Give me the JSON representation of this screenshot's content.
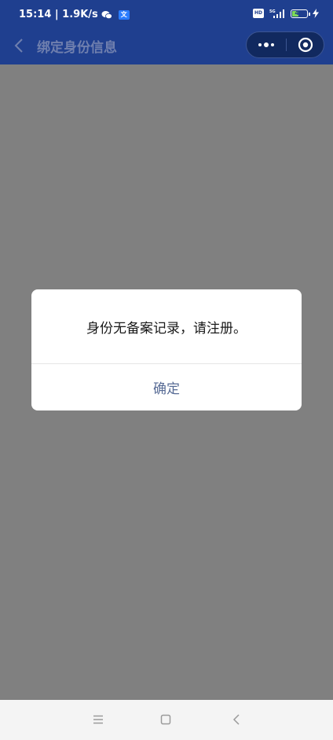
{
  "status_bar": {
    "time_speed": "15:14 | 1.9K/s",
    "app_badge": "⽂",
    "hd_label": "HD",
    "network_label": "5G",
    "battery_level": 46,
    "battery_text": "46",
    "wechat_icon": "wechat-icon",
    "signal_icon": "signal-icon",
    "charging_icon": "bolt-icon"
  },
  "nav": {
    "title": "绑定身份信息",
    "back_icon": "chevron-left-icon",
    "more_icon": "more-dots-icon",
    "close_icon": "target-circle-icon",
    "bar_color": "#1f3f8f"
  },
  "modal": {
    "message": "身份无备案记录，请注册。",
    "confirm_label": "确定",
    "confirm_color": "#576b95"
  },
  "system_nav": {
    "menu_icon": "menu-icon",
    "home_icon": "home-square-icon",
    "back_icon": "back-chevron-icon"
  }
}
